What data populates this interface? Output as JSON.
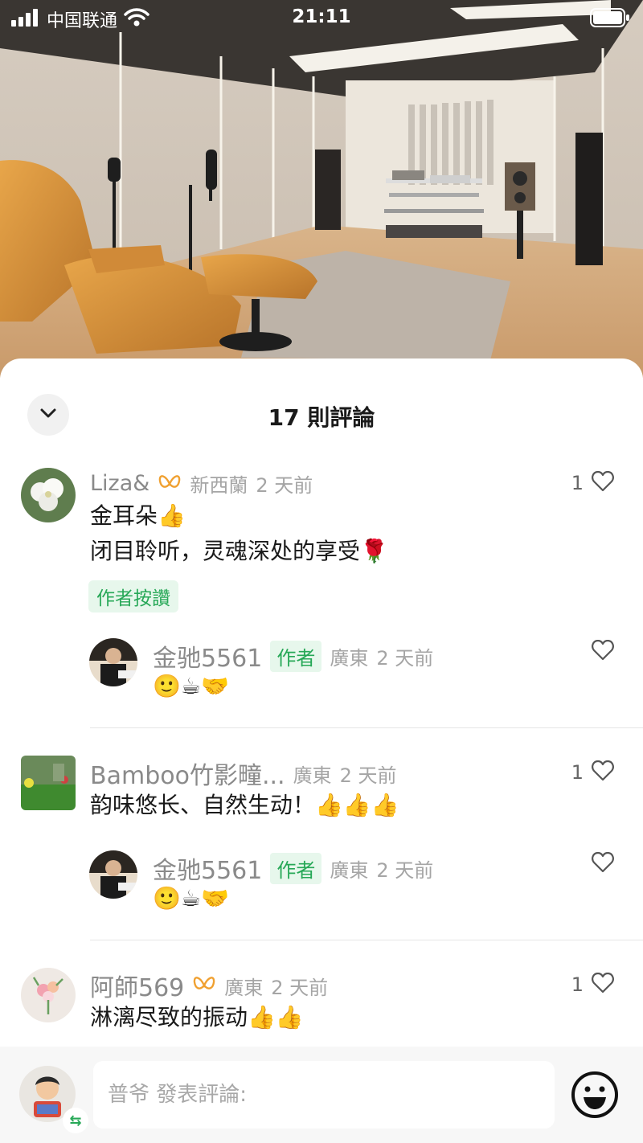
{
  "status_bar": {
    "carrier": "中国联通",
    "time": "21:11"
  },
  "sheet": {
    "title": "17 則評論"
  },
  "comments": [
    {
      "user": "Liza&",
      "location": "新西蘭",
      "time": "2 天前",
      "text_lines": [
        "金耳朵👍",
        "闭目聆听，灵魂深处的享受🌹"
      ],
      "likes": "1",
      "author_liked_label": "作者按讚",
      "reply": {
        "user": "金驰5561",
        "author_tag": "作者",
        "location": "廣東",
        "time": "2 天前",
        "text": "🙂☕🤝"
      }
    },
    {
      "user": "Bamboo竹影疃...",
      "location": "廣東",
      "time": "2 天前",
      "text": "韵味悠长、自然生动！👍👍👍",
      "likes": "1",
      "reply": {
        "user": "金驰5561",
        "author_tag": "作者",
        "location": "廣東",
        "time": "2 天前",
        "text": "🙂☕🤝"
      }
    },
    {
      "user": "阿師569",
      "location": "廣東",
      "time": "2 天前",
      "text": "淋漓尽致的振动👍👍",
      "likes": "1"
    }
  ],
  "input": {
    "placeholder": "普爷 發表評論:"
  },
  "icons": {
    "badge": "butterfly-badge-icon",
    "like": "heart-outline-icon",
    "collapse": "chevron-down-icon",
    "emoji": "smiley-icon"
  },
  "colors": {
    "accent_green": "#27a857",
    "badge_orange": "#f0a030"
  }
}
